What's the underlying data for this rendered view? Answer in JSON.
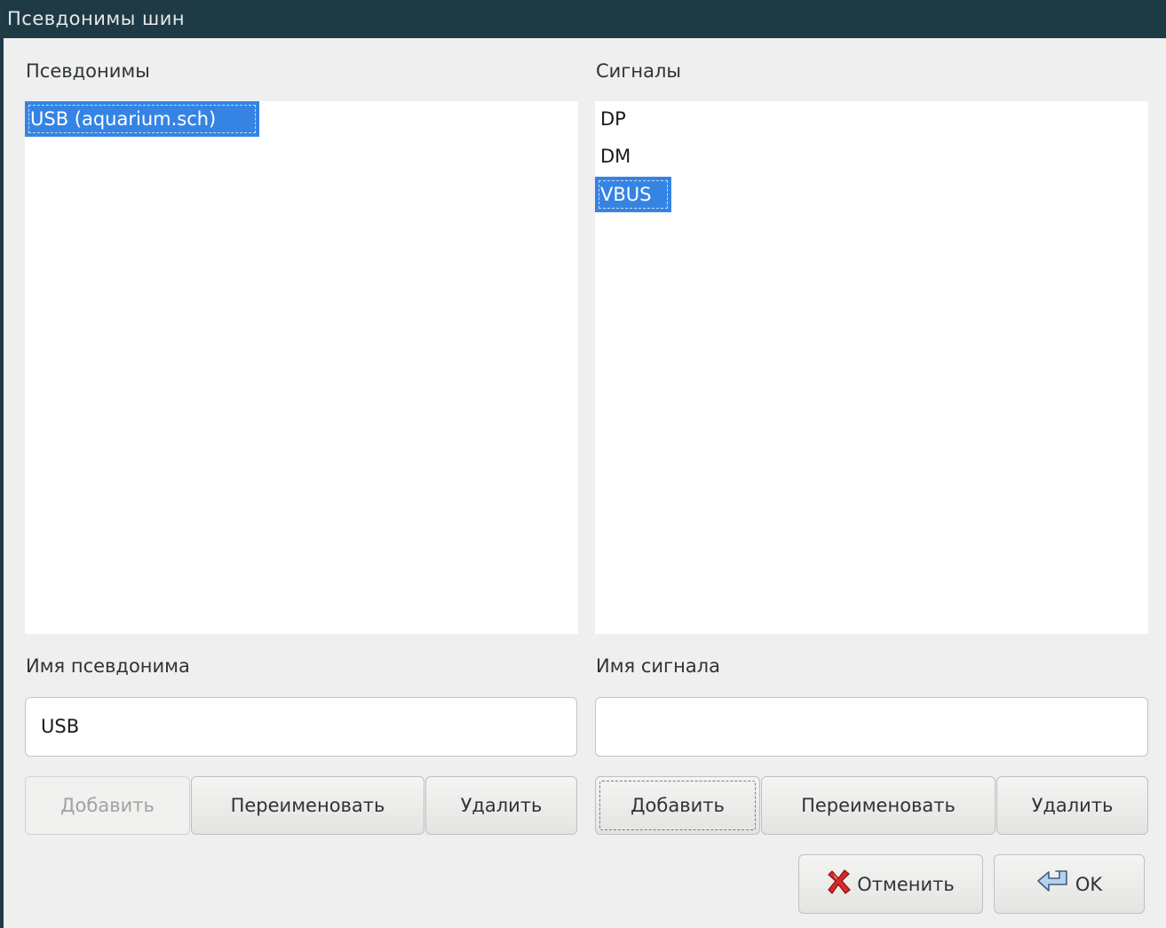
{
  "window": {
    "title": "Псевдонимы шин"
  },
  "aliases": {
    "heading": "Псевдонимы",
    "items": [
      {
        "label": "USB (aquarium.sch)",
        "selected": true
      }
    ],
    "name_label": "Имя псевдонима",
    "name_value": "USB",
    "add_label": "Добавить",
    "rename_label": "Переименовать",
    "delete_label": "Удалить"
  },
  "signals": {
    "heading": "Сигналы",
    "items": [
      {
        "label": "DP",
        "selected": false
      },
      {
        "label": "DM",
        "selected": false
      },
      {
        "label": "VBUS",
        "selected": true
      }
    ],
    "name_label": "Имя сигнала",
    "name_value": "",
    "add_label": "Добавить",
    "rename_label": "Переименовать",
    "delete_label": "Удалить"
  },
  "dialog": {
    "cancel_label": "Отменить",
    "ok_label": "OK",
    "cancel_icon": "red-x-icon",
    "ok_icon": "enter-arrow-icon"
  },
  "colors": {
    "titlebar": "#1d3a45",
    "selection": "#3584e4",
    "background": "#efefef"
  }
}
